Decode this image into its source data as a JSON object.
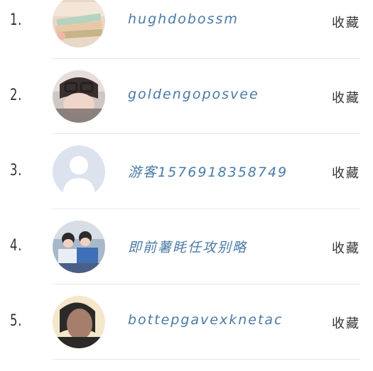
{
  "list": {
    "items": [
      {
        "rank": "1.",
        "name": "hughdobossm",
        "action": "收藏",
        "avatar": "books-icon"
      },
      {
        "rank": "2.",
        "name": "goldengoposvee",
        "action": "收藏",
        "avatar": "glasses-photo-icon"
      },
      {
        "rank": "3.",
        "name": "游客1576918358749",
        "action": "收藏",
        "avatar": "default-user-icon"
      },
      {
        "rank": "4.",
        "name": "即前薯眊任攻别略",
        "action": "收藏",
        "avatar": "students-photo-icon"
      },
      {
        "rank": "5.",
        "name": "bottepgavexknetac",
        "action": "收藏",
        "avatar": "portrait-photo-icon"
      }
    ]
  }
}
